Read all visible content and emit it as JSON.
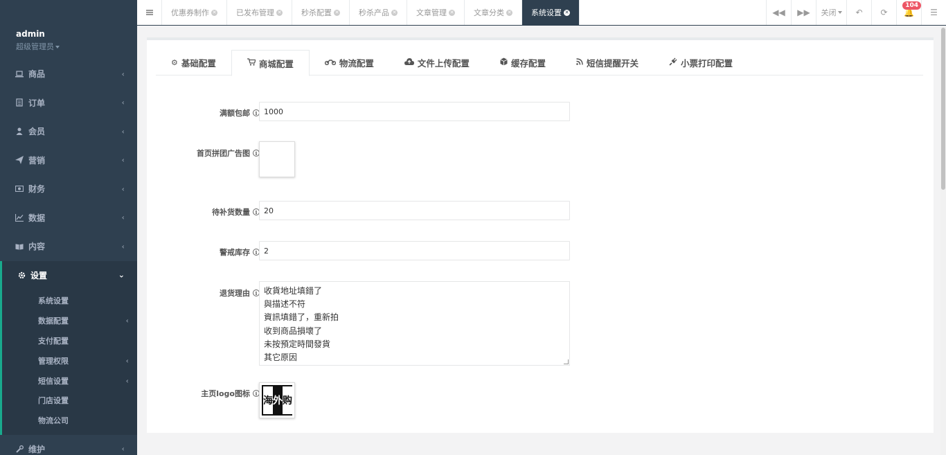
{
  "user": {
    "name": "admin",
    "role": "超级管理员"
  },
  "sidebar": {
    "items": [
      {
        "label": "商品",
        "icon": "laptop-icon"
      },
      {
        "label": "订单",
        "icon": "order-icon"
      },
      {
        "label": "会员",
        "icon": "user-icon"
      },
      {
        "label": "营销",
        "icon": "paper-plane-icon"
      },
      {
        "label": "财务",
        "icon": "money-icon"
      },
      {
        "label": "数据",
        "icon": "line-chart-icon"
      },
      {
        "label": "内容",
        "icon": "book-icon"
      },
      {
        "label": "设置",
        "icon": "gear-icon"
      },
      {
        "label": "维护",
        "icon": "wrench-icon"
      }
    ],
    "settings_sub": [
      {
        "label": "系统设置",
        "has_children": false
      },
      {
        "label": "数据配置",
        "has_children": true
      },
      {
        "label": "支付配置",
        "has_children": false
      },
      {
        "label": "管理权限",
        "has_children": true
      },
      {
        "label": "短信设置",
        "has_children": true
      },
      {
        "label": "门店设置",
        "has_children": false
      },
      {
        "label": "物流公司",
        "has_children": false
      }
    ]
  },
  "topbar": {
    "tabs": [
      "优惠券制作",
      "已发布管理",
      "秒杀配置",
      "秒杀产品",
      "文章管理",
      "文章分类",
      "系统设置"
    ],
    "close_label": "关闭",
    "notification_count": "104"
  },
  "config_tabs": [
    {
      "label": "基础配置",
      "icon": "gear-icon",
      "glyph": "✿"
    },
    {
      "label": "商城配置",
      "icon": "cart-icon",
      "glyph": "🛒"
    },
    {
      "label": "物流配置",
      "icon": "motorcycle-icon",
      "glyph": "⚙"
    },
    {
      "label": "文件上传配置",
      "icon": "cloud-upload-icon",
      "glyph": "☁"
    },
    {
      "label": "缓存配置",
      "icon": "cube-icon",
      "glyph": "◈"
    },
    {
      "label": "短信提醒开关",
      "icon": "rss-icon",
      "glyph": "◔"
    },
    {
      "label": "小票打印配置",
      "icon": "plug-icon",
      "glyph": "⚡"
    }
  ],
  "form": {
    "free_shipping": {
      "label": "满额包邮",
      "value": "1000"
    },
    "group_ad_image": {
      "label": "首页拼团广告图"
    },
    "restock_count": {
      "label": "待补货数量",
      "value": "20"
    },
    "stock_warning": {
      "label": "警戒库存",
      "value": "2"
    },
    "return_reasons": {
      "label": "退货理由",
      "value": "收貨地址填錯了\n與描述不符\n資訊填錯了，重新拍\n收到商品損壞了\n未按預定時間發貨\n其它原因"
    },
    "home_logo": {
      "label": "主页logo图标",
      "logo_chars": [
        "海",
        "外",
        "购"
      ]
    }
  }
}
